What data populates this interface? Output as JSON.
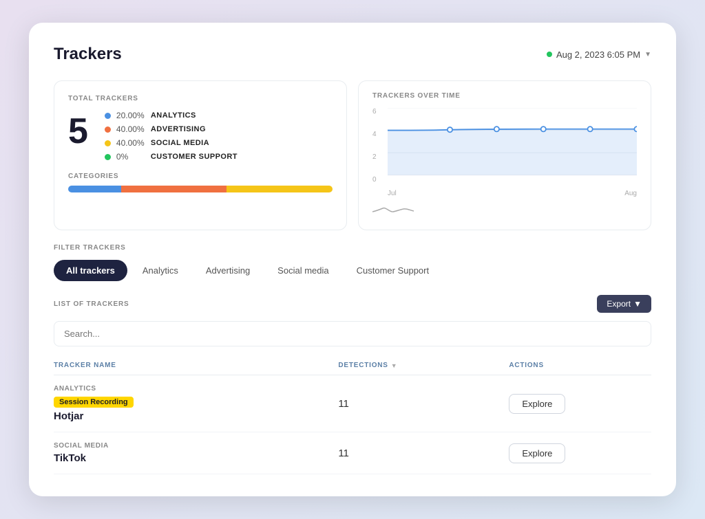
{
  "page": {
    "title": "Trackers",
    "date": "Aug 2, 2023 6:05 PM"
  },
  "stats": {
    "label": "TOTAL TRACKERS",
    "total": "5",
    "legend": [
      {
        "color": "#4a90e2",
        "pct": "20.00%",
        "name": "ANALYTICS"
      },
      {
        "color": "#f07040",
        "pct": "40.00%",
        "name": "ADVERTISING"
      },
      {
        "color": "#f5c518",
        "pct": "40.00%",
        "name": "SOCIAL MEDIA"
      },
      {
        "color": "#22c55e",
        "pct": "0%",
        "name": "CUSTOMER SUPPORT"
      }
    ],
    "categories_label": "CATEGORIES",
    "bar_segments": [
      {
        "color": "#4a90e2",
        "width": "20%"
      },
      {
        "color": "#f07040",
        "width": "40%"
      },
      {
        "color": "#f5c518",
        "width": "40%"
      }
    ]
  },
  "chart": {
    "label": "TRACKERS OVER TIME",
    "y_labels": [
      "0",
      "2",
      "4",
      "6"
    ],
    "x_labels": [
      "Jul",
      "Aug"
    ]
  },
  "filters": {
    "label": "FILTER TRACKERS",
    "tabs": [
      {
        "id": "all",
        "label": "All trackers",
        "active": true
      },
      {
        "id": "analytics",
        "label": "Analytics",
        "active": false
      },
      {
        "id": "advertising",
        "label": "Advertising",
        "active": false
      },
      {
        "id": "social",
        "label": "Social media",
        "active": false
      },
      {
        "id": "support",
        "label": "Customer Support",
        "active": false
      }
    ]
  },
  "list": {
    "label": "LIST OF TRACKERS",
    "export_btn": "Export",
    "search_placeholder": "Search...",
    "columns": [
      {
        "id": "name",
        "label": "TRACKER NAME"
      },
      {
        "id": "detections",
        "label": "DETECTIONS"
      },
      {
        "id": "actions",
        "label": "ACTIONS"
      }
    ],
    "rows": [
      {
        "category": "ANALYTICS",
        "badge": "Session Recording",
        "badge_color": "yellow",
        "name": "Hotjar",
        "detections": "11",
        "action": "Explore"
      },
      {
        "category": "SOCIAL MEDIA",
        "badge": null,
        "badge_color": null,
        "name": "TikTok",
        "detections": "11",
        "action": "Explore"
      }
    ]
  }
}
